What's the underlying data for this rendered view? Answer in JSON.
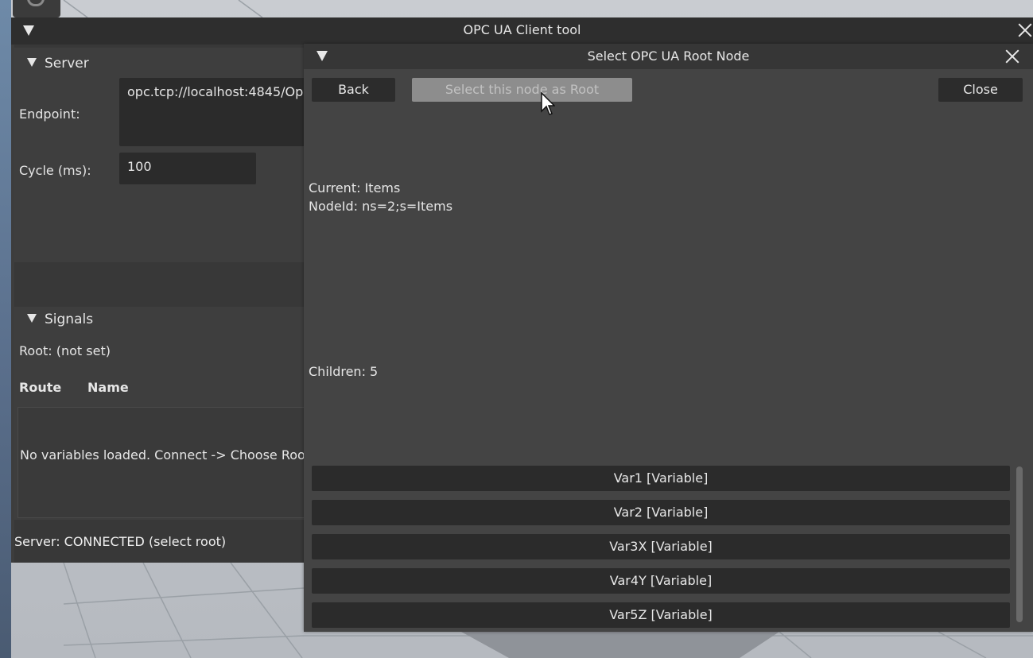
{
  "tool_window": {
    "title": "OPC UA Client tool"
  },
  "server": {
    "header": "Server",
    "endpoint_label": "Endpoint:",
    "endpoint_value": "opc.tcp://localhost:4845/Op",
    "cycle_label": "Cycle (ms):",
    "cycle_value": "100"
  },
  "signals": {
    "header": "Signals",
    "root_text": "Root: (not set)",
    "columns": [
      "Route",
      "Name"
    ],
    "empty_message": "No variables loaded. Connect -> Choose Roo"
  },
  "status": {
    "text": "Server: CONNECTED (select root)"
  },
  "modal": {
    "title": "Select OPC UA Root Node",
    "back_label": "Back",
    "select_label": "Select this node as Root",
    "close_label": "Close",
    "current": "Current: Items",
    "node_id": "NodeId: ns=2;s=Items",
    "children_count": "Children: 5",
    "children": [
      "Var1  [Variable]",
      "Var2  [Variable]",
      "Var3X  [Variable]",
      "Var4Y  [Variable]",
      "Var5Z  [Variable]"
    ]
  },
  "colors": {
    "window_bg": "#3d3d3d",
    "titlebar_bg": "#2e2e2e",
    "modal_bg": "#444444",
    "button_bg": "#2c2c2c",
    "disabled_button_bg": "#8d8d8d"
  }
}
